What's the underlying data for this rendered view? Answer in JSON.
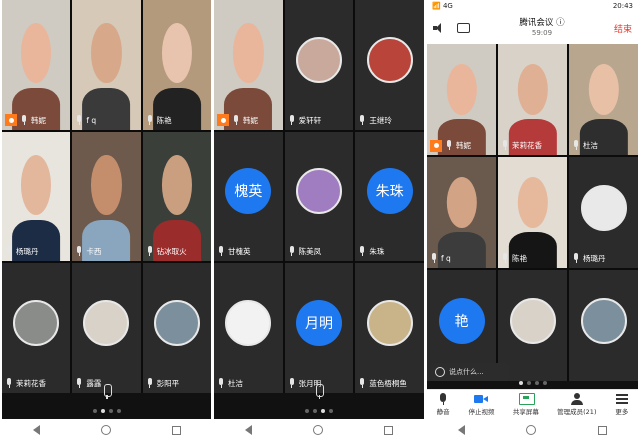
{
  "colors": {
    "avatar_blue": "#1e78f0",
    "host_orange": "#ff7a1a",
    "end_red": "#e8372c",
    "active_speaker_green": "#3ec46d"
  },
  "panel1": {
    "tiles": [
      {
        "name": "韩妮",
        "kind": "video",
        "host": true,
        "highlight": true,
        "bg": "#cfcac2",
        "skin": "#e9b69b",
        "shirt": "#7b4a3a"
      },
      {
        "name": "f q",
        "kind": "video",
        "bg": "#d6c9b8",
        "skin": "#d8a88b",
        "shirt": "#3a3a3a"
      },
      {
        "name": "陈艳",
        "kind": "video",
        "bg": "#b49a7c",
        "skin": "#e8c3ae",
        "shirt": "#222222"
      },
      {
        "name": "杨璐丹",
        "kind": "video",
        "bg": "#e8e4de",
        "skin": "#e3b79c",
        "shirt": "#1d2c45"
      },
      {
        "name": "卡西",
        "kind": "video",
        "bg": "#6d5a4c",
        "skin": "#c48e6d",
        "shirt": "#8aa6bf"
      },
      {
        "name": "钻冰取火",
        "kind": "video",
        "bg": "#3a3f3a",
        "skin": "#c99f80",
        "shirt": "#9a2c2c"
      },
      {
        "name": "茉莉花香",
        "kind": "avatar",
        "avatar_bg": "#8a8c8a"
      },
      {
        "name": "露露",
        "kind": "avatar",
        "avatar_bg": "#d9d2c8"
      },
      {
        "name": "彭阳平",
        "kind": "avatar",
        "avatar_bg": "#7c8f9c"
      }
    ],
    "dots": 4,
    "active_dot": 1
  },
  "panel2": {
    "tiles": [
      {
        "name": "韩妮",
        "kind": "video",
        "host": true,
        "highlight": true,
        "bg": "#cfcac2",
        "skin": "#e9b69b",
        "shirt": "#7b4a3a"
      },
      {
        "name": "爱轩轩",
        "kind": "avatar",
        "avatar_bg": "#c9a99c"
      },
      {
        "name": "王继玲",
        "kind": "avatar",
        "avatar_bg": "#b9443a"
      },
      {
        "name": "甘槐英",
        "kind": "text",
        "avatar_text": "槐英"
      },
      {
        "name": "陈美凤",
        "kind": "avatar",
        "avatar_bg": "#a07cc0"
      },
      {
        "name": "朱珠",
        "kind": "text",
        "avatar_text": "朱珠"
      },
      {
        "name": "杜洁",
        "kind": "avatar",
        "avatar_bg": "#f2f2f2"
      },
      {
        "name": "张月明",
        "kind": "text",
        "avatar_text": "月明"
      },
      {
        "name": "蓝色梧桐鱼",
        "kind": "avatar",
        "avatar_bg": "#c9b48a"
      }
    ],
    "dots": 4,
    "active_dot": 2
  },
  "panel3": {
    "status": {
      "left": "📶 4G",
      "time": "20:43"
    },
    "meeting": {
      "title": "腾讯会议",
      "info_icon": "ⓘ",
      "duration": "59:09",
      "end_label": "结束"
    },
    "tiles": [
      {
        "name": "韩妮",
        "kind": "video",
        "host": true,
        "bg": "#cfcac2",
        "skin": "#e9b69b",
        "shirt": "#7b4a3a"
      },
      {
        "name": "茉莉花香",
        "kind": "video",
        "bg": "#d8d2c8",
        "skin": "#e0b094",
        "shirt": "#b53a3a"
      },
      {
        "name": "杜洁",
        "kind": "video",
        "bg": "#b8a68e",
        "skin": "#e8c0a6",
        "shirt": "#2e2e2e"
      },
      {
        "name": "f q",
        "kind": "video",
        "bg": "#6a5a4d",
        "skin": "#d2a385",
        "shirt": "#3c3c3c"
      },
      {
        "name": "陈艳",
        "kind": "video",
        "bg": "#e2dcd2",
        "skin": "#e6b89c",
        "shirt": "#151515"
      },
      {
        "name": "杨璐丹",
        "kind": "avatar",
        "avatar_bg": "#e9e9e9"
      },
      {
        "name": "",
        "kind": "text",
        "avatar_text": "艳"
      },
      {
        "name": "",
        "kind": "avatar",
        "avatar_bg": "#d9d2c8"
      },
      {
        "name": "",
        "kind": "avatar",
        "avatar_bg": "#7c8f9c"
      }
    ],
    "chat_placeholder": "说点什么...",
    "toolbar": [
      {
        "label": "静音",
        "icon": "ico-mic",
        "name": "mute-button"
      },
      {
        "label": "停止视频",
        "icon": "ico-video",
        "name": "stop-video-button"
      },
      {
        "label": "共享屏幕",
        "icon": "ico-share",
        "name": "share-screen-button"
      },
      {
        "label": "管理成员(21)",
        "icon": "ico-members",
        "name": "manage-members-button"
      },
      {
        "label": "更多",
        "icon": "ico-more",
        "name": "more-button"
      }
    ],
    "dots": 4,
    "active_dot": 0
  }
}
